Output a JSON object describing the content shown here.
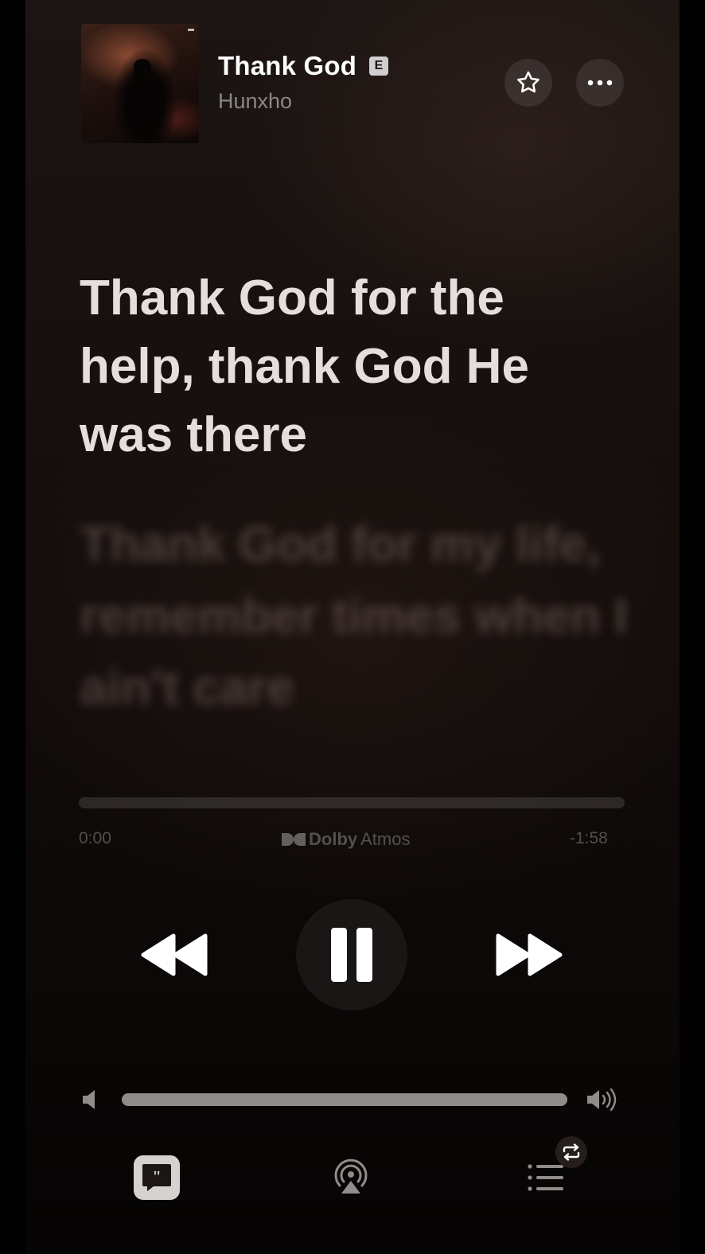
{
  "now_playing": {
    "title": "Thank God",
    "explicit_badge": "E",
    "artist": "Hunxho"
  },
  "header_actions": {
    "favorite_icon": "star-outline-icon",
    "more_icon": "ellipsis-icon"
  },
  "lyrics": {
    "active_line": "Thank God for the help, thank God He was there",
    "next_line": "Thank God for my life, remember times when I ain't care"
  },
  "playback": {
    "elapsed": "0:00",
    "remaining": "-1:58",
    "progress_fraction": 0.0,
    "audio_format": "Dolby Atmos",
    "dolby_word": "Dolby",
    "atmos_word": "Atmos"
  },
  "controls": {
    "previous_icon": "rewind-icon",
    "play_pause_icon": "pause-icon",
    "next_icon": "fast-forward-icon"
  },
  "volume": {
    "level_fraction": 1.0,
    "min_icon": "speaker-low-icon",
    "max_icon": "speaker-high-icon"
  },
  "bottom_bar": {
    "lyrics_icon": "lyrics-quote-icon",
    "airplay_icon": "airplay-icon",
    "queue_icon": "queue-list-icon",
    "repeat_icon": "repeat-icon"
  },
  "colors": {
    "accent_text": "#e6dedd",
    "muted_text": "#8c8784"
  }
}
